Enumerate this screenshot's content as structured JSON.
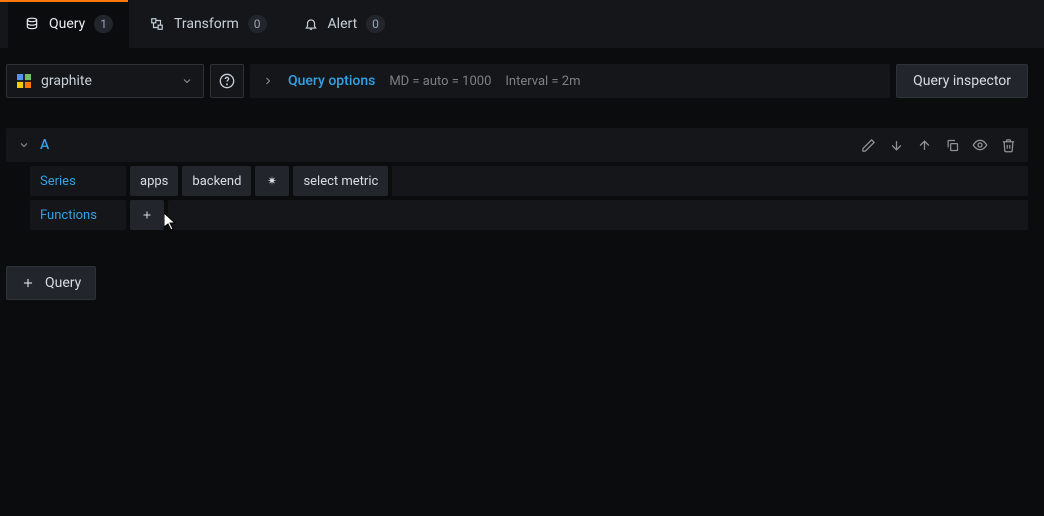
{
  "tabs": {
    "query": {
      "label": "Query",
      "count": "1"
    },
    "transform": {
      "label": "Transform",
      "count": "0"
    },
    "alert": {
      "label": "Alert",
      "count": "0"
    }
  },
  "datasource": {
    "name": "graphite"
  },
  "queryOptions": {
    "label": "Query options",
    "md": "MD = auto = 1000",
    "interval": "Interval = 2m"
  },
  "inspector": {
    "label": "Query inspector"
  },
  "rows": [
    {
      "name": "A",
      "seriesLabel": "Series",
      "series": [
        "apps",
        "backend",
        "*",
        "select metric"
      ],
      "functionsLabel": "Functions"
    }
  ],
  "addQuery": {
    "label": "Query"
  }
}
